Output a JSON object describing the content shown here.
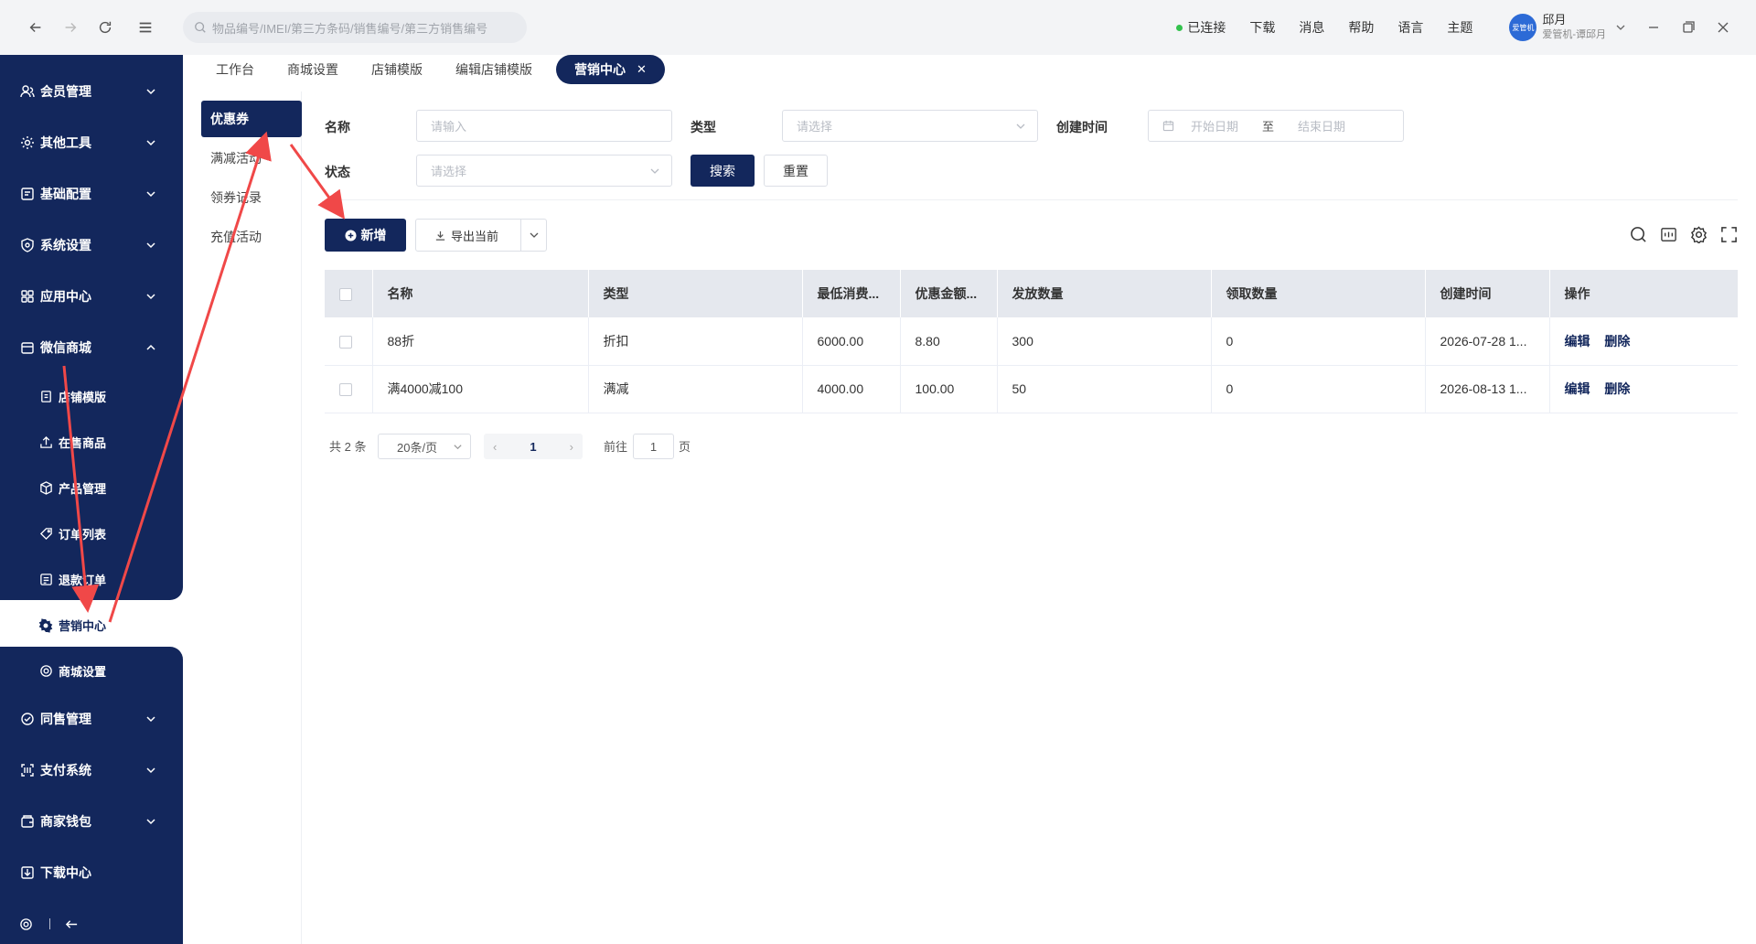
{
  "topbar": {
    "search_placeholder": "物品编号/IMEI/第三方条码/销售编号/第三方销售编号",
    "status": "已连接",
    "links": [
      "下载",
      "消息",
      "帮助",
      "语言",
      "主题"
    ],
    "user_name": "邱月",
    "user_sub": "爱管机-谭邱月",
    "avatar_text": "爱管机"
  },
  "sidebar": {
    "items": [
      {
        "label": "会员管理",
        "icon": "member-icon"
      },
      {
        "label": "其他工具",
        "icon": "tools-icon"
      },
      {
        "label": "基础配置",
        "icon": "config-icon"
      },
      {
        "label": "系统设置",
        "icon": "shield-icon"
      },
      {
        "label": "应用中心",
        "icon": "apps-icon"
      },
      {
        "label": "微信商城",
        "icon": "shop-icon"
      }
    ],
    "subitems": [
      {
        "label": "店铺模版",
        "icon": "template-icon"
      },
      {
        "label": "在售商品",
        "icon": "upload-icon"
      },
      {
        "label": "产品管理",
        "icon": "box-icon"
      },
      {
        "label": "订单列表",
        "icon": "tag-icon"
      },
      {
        "label": "退款订单",
        "icon": "refund-icon"
      }
    ],
    "active": {
      "label": "营销中心",
      "icon": "marketing-icon"
    },
    "after_active": {
      "label": "商城设置",
      "icon": "gear-icon"
    },
    "bottom_items": [
      {
        "label": "同售管理",
        "icon": "sync-icon"
      },
      {
        "label": "支付系统",
        "icon": "scan-icon"
      },
      {
        "label": "商家钱包",
        "icon": "wallet-icon"
      },
      {
        "label": "下载中心",
        "icon": "download-icon"
      }
    ]
  },
  "tabs": [
    "工作台",
    "商城设置",
    "店铺模版",
    "编辑店铺模版"
  ],
  "active_tab": "营销中心",
  "submenu": {
    "active": "优惠券",
    "items": [
      "满减活动",
      "领券记录",
      "充值活动"
    ]
  },
  "filters": {
    "name_label": "名称",
    "name_placeholder": "请输入",
    "type_label": "类型",
    "type_placeholder": "请选择",
    "created_label": "创建时间",
    "start_placeholder": "开始日期",
    "to": "至",
    "end_placeholder": "结束日期",
    "status_label": "状态",
    "status_placeholder": "请选择",
    "search_btn": "搜索",
    "reset_btn": "重置"
  },
  "toolbar": {
    "add_btn": "新增",
    "export_btn": "导出当前"
  },
  "table": {
    "headers": [
      "名称",
      "类型",
      "最低消费...",
      "优惠金额...",
      "发放数量",
      "领取数量",
      "创建时间",
      "操作"
    ],
    "rows": [
      [
        "88折",
        "折扣",
        "6000.00",
        "8.80",
        "300",
        "0",
        "2026-07-28 1..."
      ],
      [
        "满4000减100",
        "满减",
        "4000.00",
        "100.00",
        "50",
        "0",
        "2026-08-13 1..."
      ]
    ],
    "edit_label": "编辑",
    "delete_label": "删除"
  },
  "pagination": {
    "total": "共 2 条",
    "page_size": "20条/页",
    "current": "1",
    "goto_prefix": "前往",
    "goto_value": "1",
    "goto_suffix": "页"
  },
  "colors": {
    "primary": "#13275c",
    "annotation_arrow": "#f04848",
    "status_green": "#33c24d"
  }
}
